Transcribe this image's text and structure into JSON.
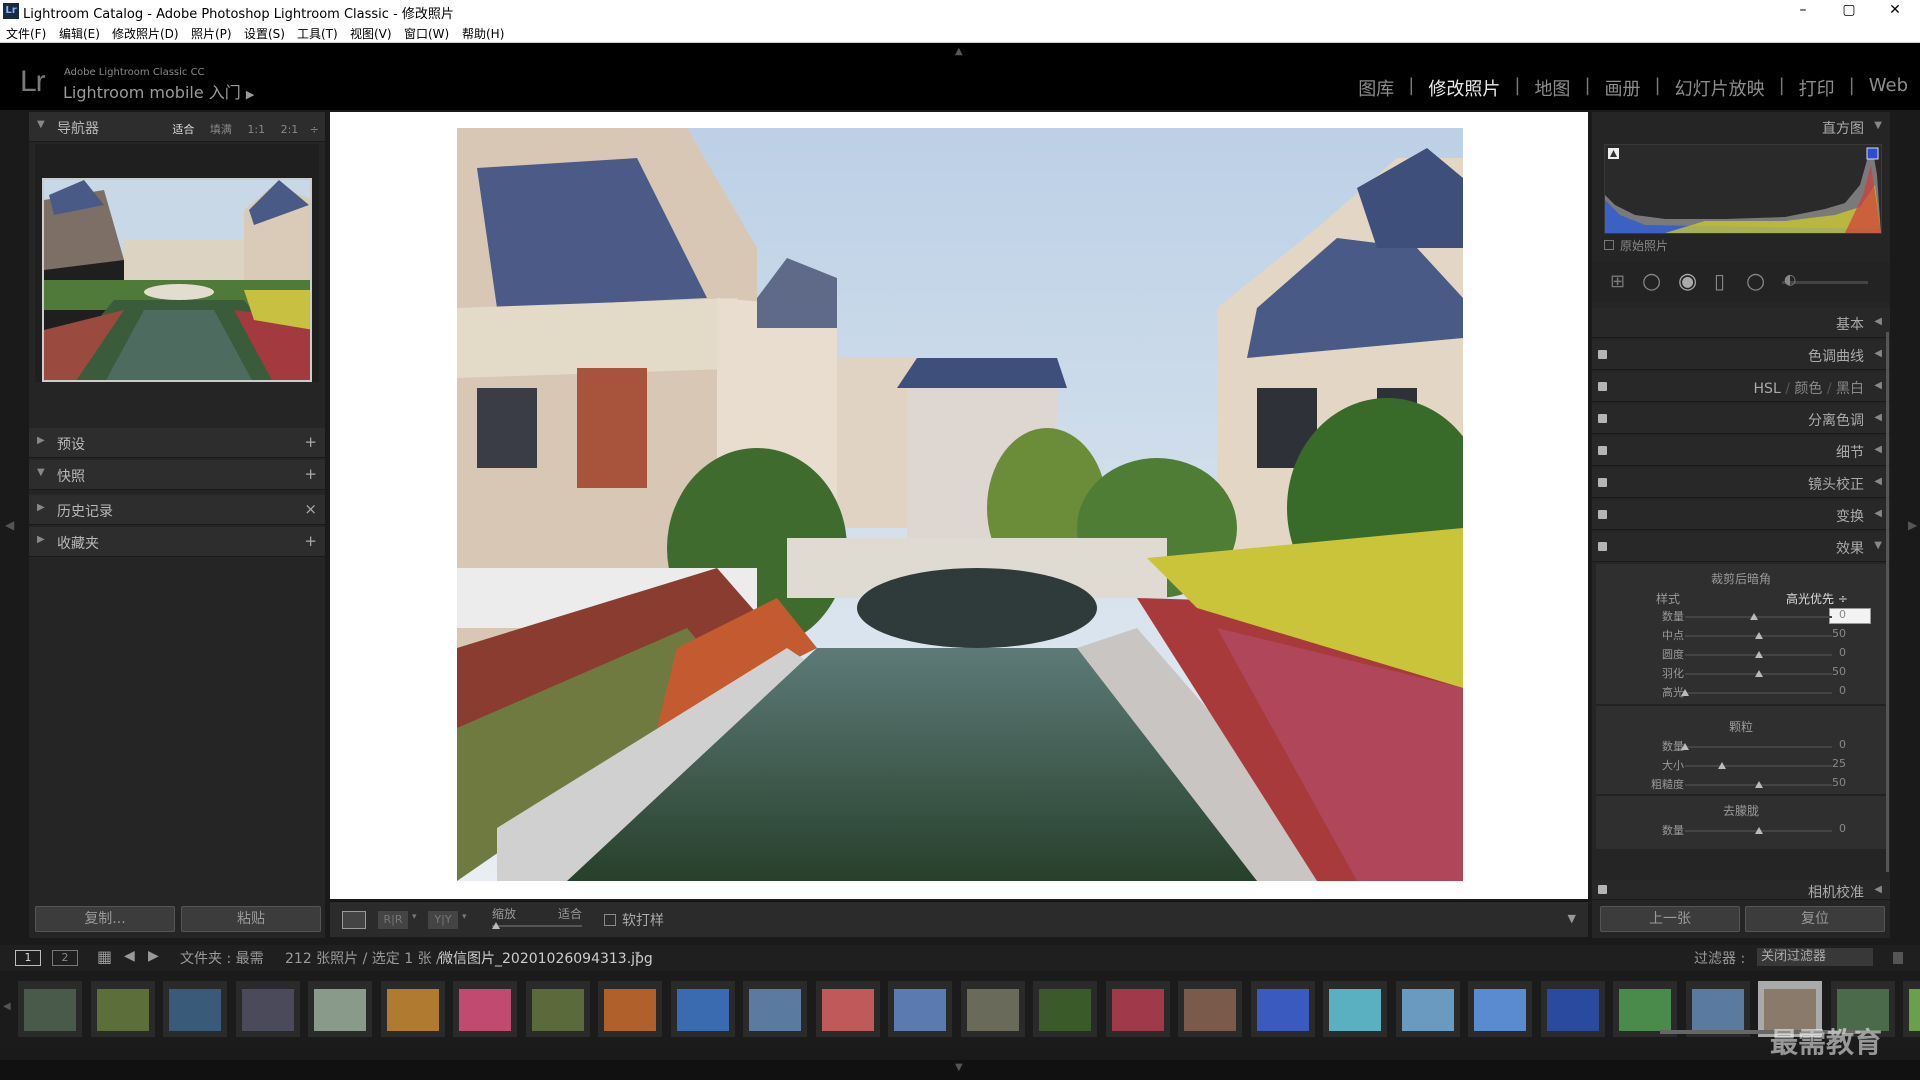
{
  "window": {
    "title": "Lightroom Catalog - Adobe Photoshop Lightroom Classic - 修改照片",
    "app_icon": "Lr",
    "min": "–",
    "max": "▢",
    "close": "✕"
  },
  "menu": [
    "文件(F)",
    "编辑(E)",
    "修改照片(D)",
    "照片(P)",
    "设置(S)",
    "工具(T)",
    "视图(V)",
    "窗口(W)",
    "帮助(H)"
  ],
  "header": {
    "logo": "Lr",
    "product": "Adobe Lightroom Classic CC",
    "mobile": "Lightroom mobile 入门",
    "modules": [
      "图库",
      "修改照片",
      "地图",
      "画册",
      "幻灯片放映",
      "打印",
      "Web"
    ],
    "active_module": "修改照片"
  },
  "left": {
    "navigator": {
      "label": "导航器",
      "fit": "适合",
      "fill": "填满",
      "r1": "1:1",
      "r2": "2:1"
    },
    "panels": [
      {
        "label": "预设",
        "action": "+"
      },
      {
        "label": "快照",
        "action": "+"
      },
      {
        "label": "历史记录",
        "action": "×"
      },
      {
        "label": "收藏夹",
        "action": "+"
      }
    ],
    "copy": "复制...",
    "paste": "粘贴"
  },
  "toolbar": {
    "zoom_label": "缩放",
    "zoom_value": "适合",
    "softproof": "软打样"
  },
  "right": {
    "histogram": "直方图",
    "original": "原始照片",
    "sections": [
      "基本",
      "色调曲线",
      "分离色调",
      "细节",
      "镜头校正",
      "变换",
      "效果",
      "相机校准"
    ],
    "hsl": {
      "a": "HSL",
      "b": "颜色",
      "c": "黑白"
    },
    "vignette": {
      "title": "裁剪后暗角",
      "style_label": "样式",
      "style_value": "高光优先 ÷",
      "rows": [
        {
          "label": "数量",
          "value": "0",
          "pos": 0.47
        },
        {
          "label": "中点",
          "value": "50",
          "pos": 0.5
        },
        {
          "label": "圆度",
          "value": "0",
          "pos": 0.5
        },
        {
          "label": "羽化",
          "value": "50",
          "pos": 0.5
        },
        {
          "label": "高光",
          "value": "0",
          "pos": 0.0
        }
      ]
    },
    "grain": {
      "title": "颗粒",
      "rows": [
        {
          "label": "数量",
          "value": "0",
          "pos": 0.0
        },
        {
          "label": "大小",
          "value": "25",
          "pos": 0.25
        },
        {
          "label": "粗糙度",
          "value": "50",
          "pos": 0.5
        }
      ]
    },
    "dehaze": {
      "title": "去朦胧",
      "rows": [
        {
          "label": "数量",
          "value": "0",
          "pos": 0.5
        }
      ]
    },
    "prev": "上一张",
    "reset": "复位"
  },
  "filmbar": {
    "view1": "1",
    "view2": "2",
    "folder": "文件夹 : 最需",
    "count": "212 张照片 / 选定 1 张 /",
    "filename": "微信图片_20201026094313.jpg",
    "filter_label": "过滤器 :",
    "filter_value": "关闭过滤器"
  },
  "watermark": "最需教育",
  "colors": {
    "panel_bg": "#252525",
    "header_bg": "#000000",
    "accent": "#e8e8e8"
  }
}
